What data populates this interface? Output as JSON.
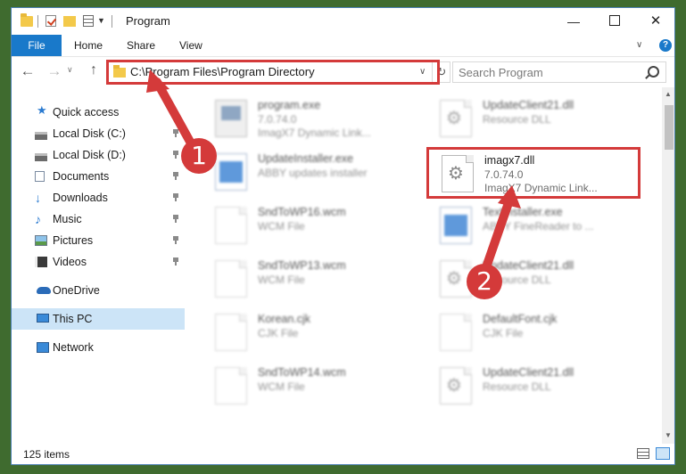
{
  "window": {
    "title": "Program",
    "buttons": {
      "minimize": "—",
      "maximize": "",
      "close": "✕"
    }
  },
  "ribbon": {
    "tabs": [
      {
        "label": "File"
      },
      {
        "label": "Home"
      },
      {
        "label": "Share"
      },
      {
        "label": "View"
      }
    ],
    "help": "?"
  },
  "address": {
    "path": "C:\\Program Files\\Program Directory",
    "search_placeholder": "Search Program"
  },
  "nav": {
    "items": [
      {
        "label": "Quick access",
        "icon": "star-icon"
      },
      {
        "label": "Local Disk (C:)",
        "icon": "disk-icon",
        "pinned": true
      },
      {
        "label": "Local Disk (D:)",
        "icon": "disk-icon",
        "pinned": true
      },
      {
        "label": "Documents",
        "icon": "documents-icon",
        "pinned": true
      },
      {
        "label": "Downloads",
        "icon": "downloads-icon",
        "pinned": true
      },
      {
        "label": "Music",
        "icon": "music-icon",
        "pinned": true
      },
      {
        "label": "Pictures",
        "icon": "pictures-icon",
        "pinned": true
      },
      {
        "label": "Videos",
        "icon": "videos-icon",
        "pinned": true
      },
      {
        "label": "OneDrive",
        "icon": "onedrive-icon"
      },
      {
        "label": "This PC",
        "icon": "this-pc-icon",
        "selected": true
      },
      {
        "label": "Network",
        "icon": "network-icon"
      }
    ]
  },
  "files": [
    {
      "name": "program.exe",
      "type": "7.0.74.0",
      "desc": "ImagX7 Dynamic Link...",
      "icon": "program-icon"
    },
    {
      "name": "UpdateClient21.dll",
      "type": "Resource DLL",
      "desc": "",
      "icon": "gear-file-icon"
    },
    {
      "name": "UpdateInstaller.exe",
      "type": "ABBY updates installer",
      "desc": "",
      "icon": "installer-icon"
    },
    {
      "name": "imagx7.dll",
      "type": "7.0.74.0",
      "desc": "ImagX7 Dynamic Link...",
      "icon": "gear-file-icon"
    },
    {
      "name": "SndToWP16.wcm",
      "type": "WCM File",
      "desc": "",
      "icon": "file-icon"
    },
    {
      "name": "TextInstaller.exe",
      "type": "ABBY FineReader to ...",
      "desc": "",
      "icon": "installer-icon"
    },
    {
      "name": "SndToWP13.wcm",
      "type": "WCM File",
      "desc": "",
      "icon": "file-icon"
    },
    {
      "name": "UpdateClient21.dll",
      "type": "Resource DLL",
      "desc": "",
      "icon": "gear-file-icon"
    },
    {
      "name": "Korean.cjk",
      "type": "CJK File",
      "desc": "",
      "icon": "file-icon"
    },
    {
      "name": "DefaultFont.cjk",
      "type": "CJK File",
      "desc": "",
      "icon": "file-icon"
    },
    {
      "name": "SndToWP14.wcm",
      "type": "WCM File",
      "desc": "",
      "icon": "file-icon"
    },
    {
      "name": "UpdateClient21.dll",
      "type": "Resource DLL",
      "desc": "",
      "icon": "gear-file-icon"
    }
  ],
  "status": {
    "count": "125 items"
  },
  "annotations": {
    "step1": "1",
    "step2": "2",
    "color": "#d43a3a"
  }
}
